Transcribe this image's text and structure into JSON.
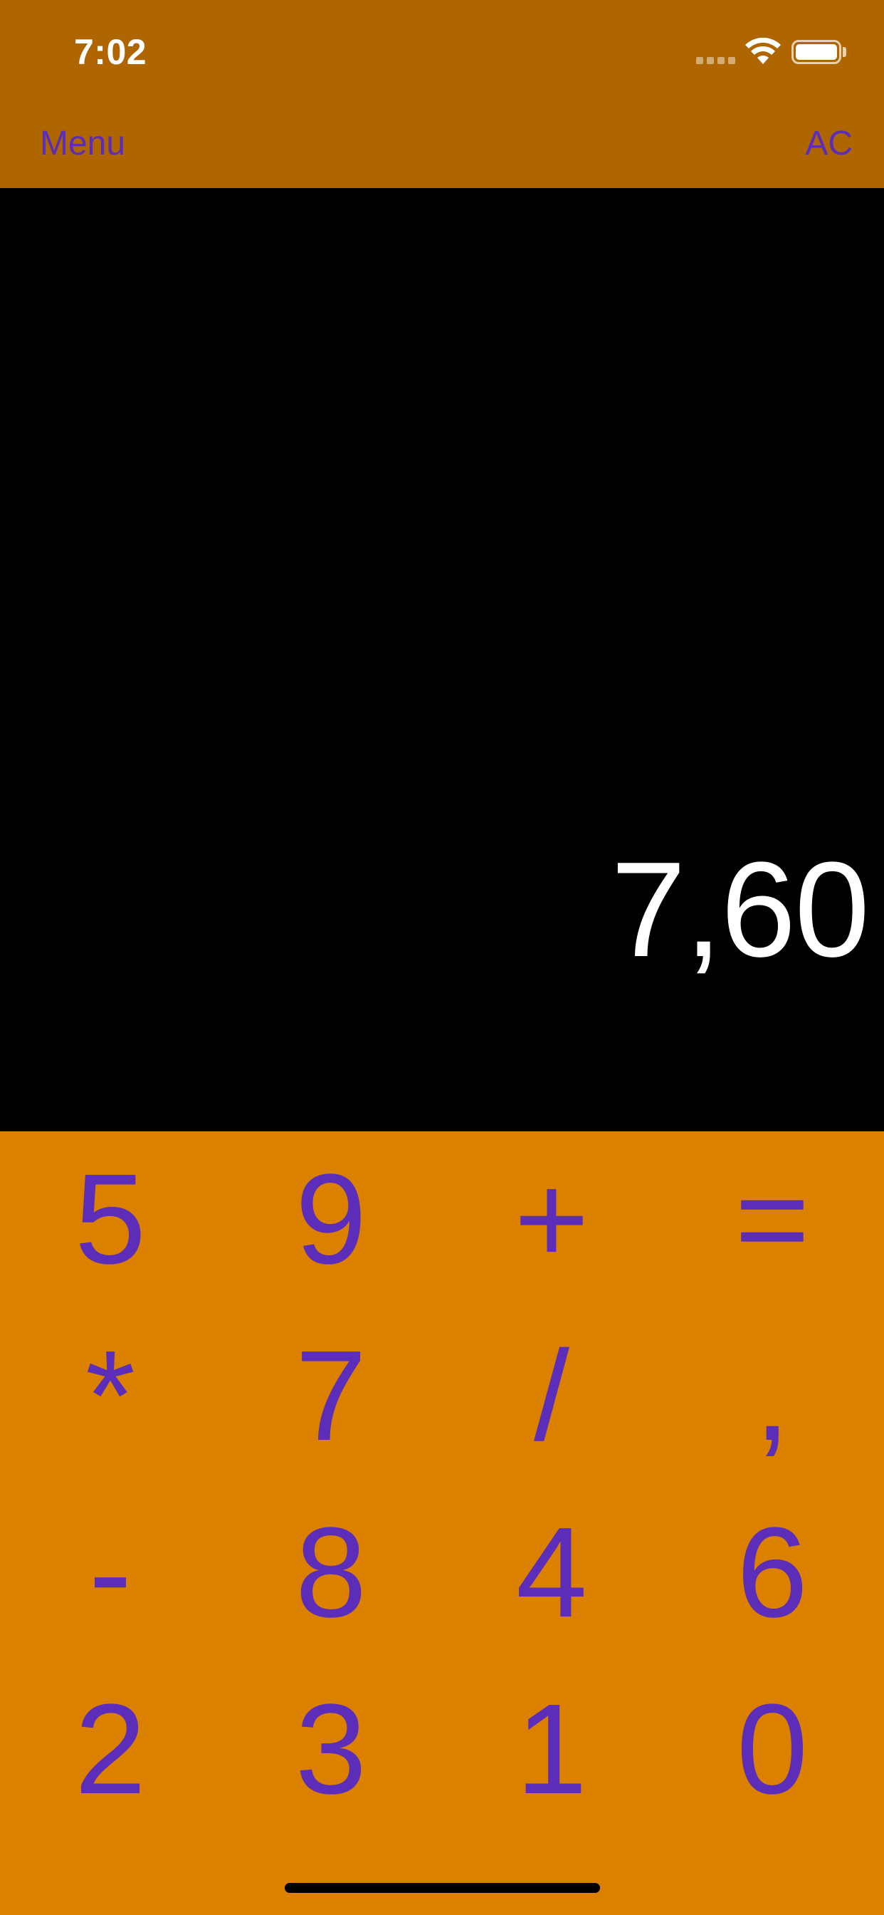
{
  "status_bar": {
    "time": "7:02",
    "wifi_icon": "wifi-icon",
    "battery_icon": "battery-icon",
    "signal_icon": "cellular-signal-icon"
  },
  "nav": {
    "menu_label": "Menu",
    "clear_label": "AC"
  },
  "display": {
    "value": "7,60"
  },
  "keypad": {
    "rows": [
      [
        "5",
        "9",
        "+",
        "="
      ],
      [
        "*",
        "7",
        "/",
        ","
      ],
      [
        "-",
        "8",
        "4",
        "6"
      ],
      [
        "2",
        "3",
        "1",
        "0"
      ]
    ]
  },
  "colors": {
    "header_bg": "#B06600",
    "keypad_bg": "#DC8000",
    "accent_text": "#5B2DB8",
    "display_bg": "#000000",
    "display_text": "#FFFFFF"
  }
}
